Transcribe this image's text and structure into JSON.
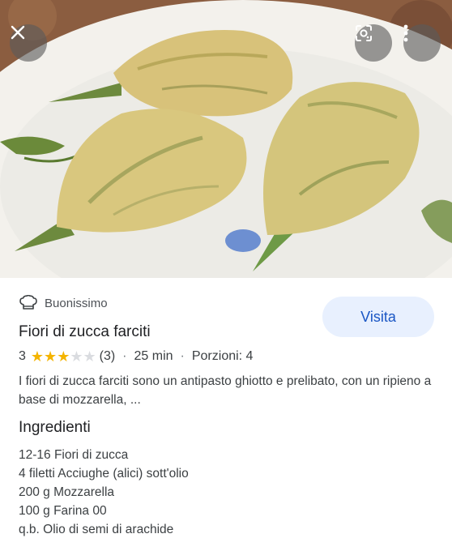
{
  "photo": {
    "close_icon": "close-icon",
    "lens_icon": "lens-icon",
    "more_icon": "more-vertical-icon"
  },
  "source": {
    "icon": "chef-hat-icon",
    "name": "Buonissimo"
  },
  "visit_button": {
    "label": "Visita",
    "color": "#1a56c4"
  },
  "recipe": {
    "title": "Fiori di zucca farciti",
    "rating_value": "3",
    "rating_stars": 3,
    "rating_max": 5,
    "review_count": "(3)",
    "time": "25 min",
    "servings": "Porzioni: 4",
    "separator": "·",
    "description": "I fiori di zucca farciti sono un antipasto ghiotto e prelibato, con un ripieno a base di mozzarella, ...",
    "star_color": "#f4b400"
  },
  "ingredients": {
    "heading": "Ingredienti",
    "items": [
      "12-16 Fiori di zucca",
      "4 filetti Acciughe (alici) sott'olio",
      "200 g Mozzarella",
      "100 g Farina 00",
      "q.b. Olio di semi di arachide"
    ]
  }
}
